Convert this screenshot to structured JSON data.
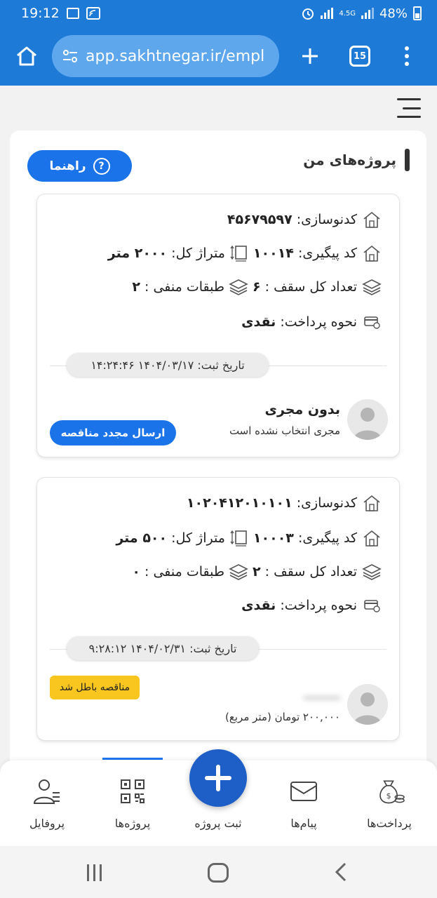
{
  "status_bar": {
    "time": "19:12",
    "battery": "48%",
    "network": "4.5G"
  },
  "browser": {
    "url": "app.sakhtnegar.ir/empl",
    "tab_count": "15"
  },
  "section": {
    "title": "پروژه‌های من",
    "help_label": "راهنما"
  },
  "projects": [
    {
      "code_label": "کدنوسازی:",
      "code_value": "۴۵۶۷۹۵۹۷",
      "tracking_label": "کد پیگیری:",
      "tracking_value": "۱۰۰۱۴",
      "area_label": "متراژ کل:",
      "area_value": "۲۰۰۰ متر",
      "floors_label": "تعداد کل سقف :",
      "floors_value": "۶",
      "basement_label": "طبقات منفی :",
      "basement_value": "۲",
      "payment_label": "نحوه پرداخت:",
      "payment_value": "نقدی",
      "date_text": "تاریخ ثبت: ۱۴۰۴/۰۳/۱۷ ۱۴:۲۴:۴۶",
      "executor_name": "بدون مجری",
      "executor_sub": "مجری انتخاب نشده است",
      "action_label": "ارسال مجدد مناقصه"
    },
    {
      "code_label": "کدنوسازی:",
      "code_value": "۱۰۲۰۴۱۲۰۱۰۱۰۱",
      "tracking_label": "کد پیگیری:",
      "tracking_value": "۱۰۰۰۳",
      "area_label": "متراژ کل:",
      "area_value": "۵۰۰ متر",
      "floors_label": "تعداد کل سقف :",
      "floors_value": "۲",
      "basement_label": "طبقات منفی :",
      "basement_value": "۰",
      "payment_label": "نحوه پرداخت:",
      "payment_value": "نقدی",
      "date_text": "تاریخ ثبت: ۱۴۰۴/۰۲/۳۱ ۹:۲۸:۱۲",
      "executor_name": "ــــــــ",
      "executor_sub": "۲۰۰,۰۰۰ تومان (متر مربع)",
      "status_badge": "مناقصه باطل شد"
    }
  ],
  "bottom_nav": {
    "payments": "پرداخت‌ها",
    "messages": "پیام‌ها",
    "new_project": "ثبت پروژه",
    "projects": "پروژه‌ها",
    "profile": "پروفایل"
  }
}
